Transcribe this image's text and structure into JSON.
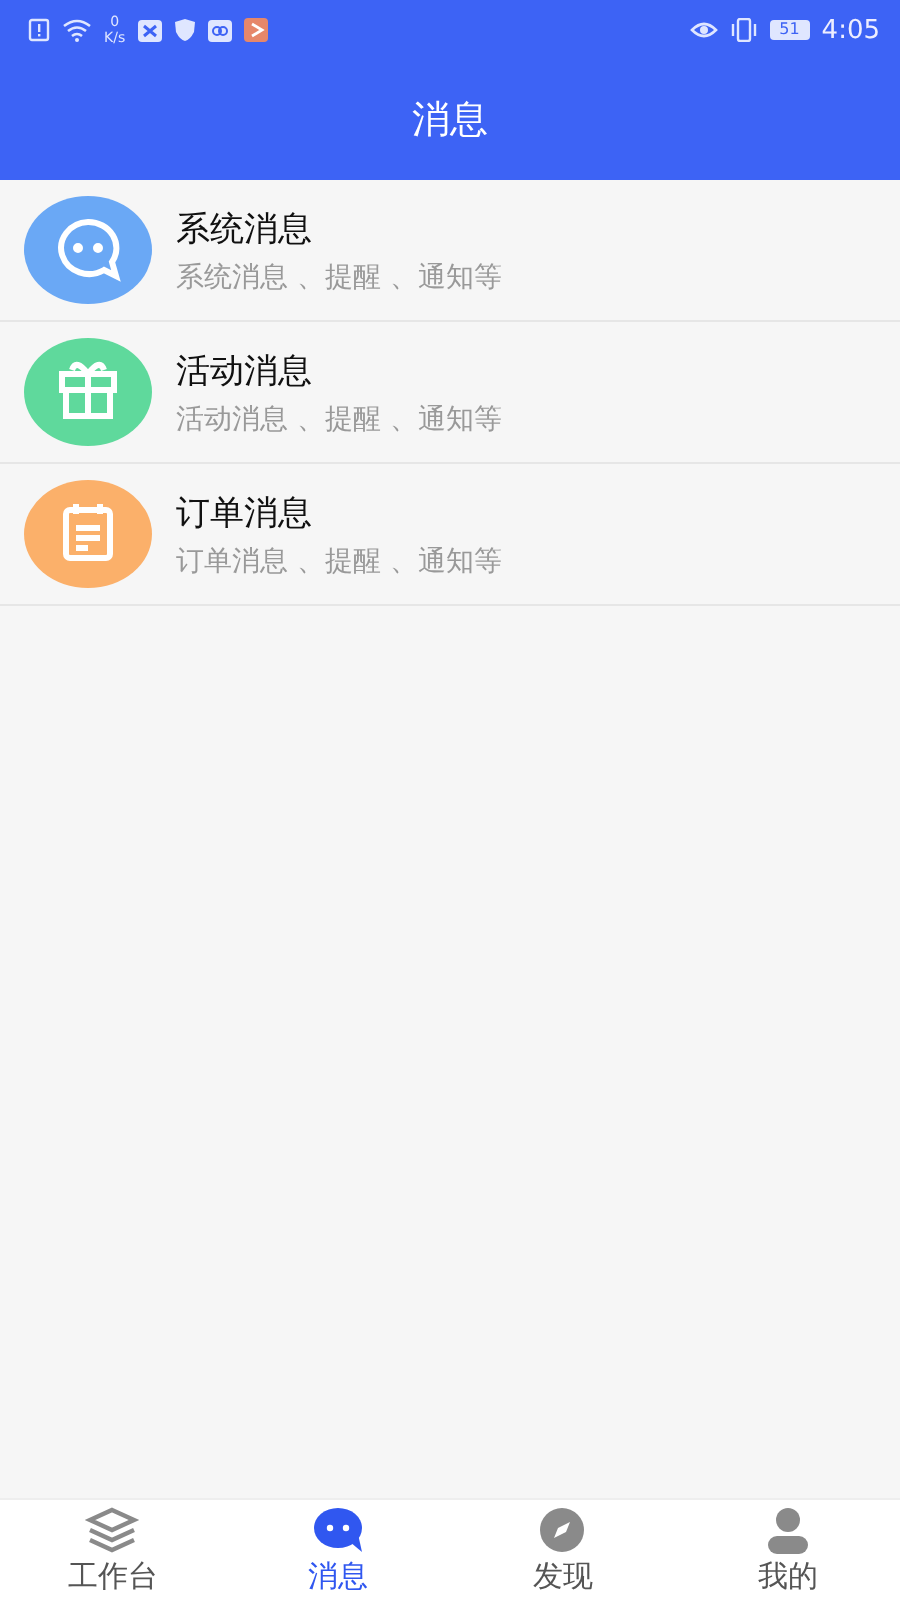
{
  "status_bar": {
    "speed": "0",
    "speed_unit": "K/s",
    "battery": "51",
    "time": "4:05"
  },
  "header": {
    "title": "消息"
  },
  "messages": [
    {
      "kind": "chat",
      "color": "#6aa8f5",
      "title": "系统消息",
      "subtitle": "系统消息 、提醒 、通知等"
    },
    {
      "kind": "gift",
      "color": "#5fd99c",
      "title": "活动消息",
      "subtitle": "活动消息 、提醒 、通知等"
    },
    {
      "kind": "calendar",
      "color": "#fbb06a",
      "title": "订单消息",
      "subtitle": "订单消息 、提醒 、通知等"
    }
  ],
  "tab_bar": [
    {
      "kind": "layers",
      "label": "工作台",
      "selected": false
    },
    {
      "kind": "chat",
      "label": "消息",
      "selected": true
    },
    {
      "kind": "compass",
      "label": "发现",
      "selected": false
    },
    {
      "kind": "person",
      "label": "我的",
      "selected": false
    }
  ]
}
